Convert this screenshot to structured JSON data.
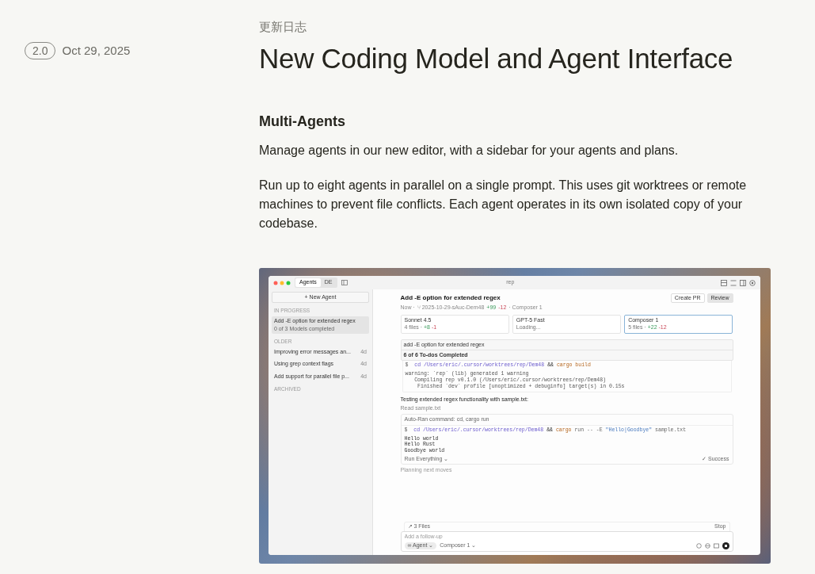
{
  "version": "2.0",
  "date": "Oct 29, 2025",
  "section_label": "更新日志",
  "title": "New Coding Model and Agent Interface",
  "heading": "Multi-Agents",
  "paragraphs": [
    "Manage agents in our new editor, with a sidebar for your agents and plans.",
    "Run up to eight agents in parallel on a single prompt. This uses git worktrees or remote machines to prevent file conflicts. Each agent operates in its own isolated copy of your codebase."
  ],
  "app": {
    "tabs": [
      {
        "label": "Agents",
        "selected": true
      },
      {
        "label": "DE",
        "selected": false
      }
    ],
    "window_title": "rep",
    "new_agent": "+ New Agent",
    "sidebar_sections": [
      {
        "label": "IN PROGRESS",
        "items": [
          {
            "title": "Add -E option for extended regex",
            "status": "0 of 3 Models completed",
            "selected": true
          }
        ]
      },
      {
        "label": "OLDER",
        "items": [
          {
            "title": "Improving error messages an...",
            "time": "4d",
            "selected": false
          },
          {
            "title": "Using grep context flags",
            "time": "4d",
            "selected": false
          },
          {
            "title": "Add support for parallel file p...",
            "time": "4d",
            "selected": false
          }
        ]
      },
      {
        "label": "ARCHIVED"
      }
    ],
    "agent_title": "Add -E option for extended regex",
    "buttons": [
      {
        "label": "Create PR",
        "kind": "outline"
      },
      {
        "label": "Review",
        "kind": "filled"
      }
    ],
    "meta": {
      "time": "Now ·",
      "branch": "⑂ 2025-10-29-sAuc-Dem48",
      "added": "+99",
      "removed": "-12",
      "model": "· Composer 1"
    },
    "models": [
      {
        "name": "Sonnet 4.5",
        "files": "4 files ·",
        "added": "+8",
        "removed": "-1",
        "selected": false
      },
      {
        "name": "GPT-5 Fast",
        "status": "Loading...",
        "selected": false
      },
      {
        "name": "Composer 1",
        "files": "5 files ·",
        "added": "+22",
        "removed": "-12",
        "selected": true
      }
    ],
    "task_card": {
      "title": "add -E option for extended regex",
      "todos": "6 of 6 To-dos Completed"
    },
    "terminal": {
      "prompt": "$",
      "command": [
        {
          "text": "cd /Users/eric/.cursor/worktrees/rep/Dem48",
          "kind": "path"
        },
        {
          "text": "&&",
          "kind": "op"
        },
        {
          "text": "cargo build",
          "kind": "cmd"
        }
      ],
      "output": [
        "warning: `rep` (lib) generated 1 warning",
        "   Compiling rep v0.1.0 (/Users/eric/.cursor/worktrees/rep/Dem48)",
        "    Finished `dev` profile [unoptimized + debuginfo] target(s) in 0.15s"
      ]
    },
    "message": "Testing extended regex functionality with sample.txt:",
    "read": "Read sample.txt",
    "run_card": {
      "header": "Auto-Ran command: cd, cargo run",
      "prompt": "$",
      "command": [
        {
          "text": "cd /Users/eric/.cursor/worktrees/rep/Dem48",
          "kind": "path"
        },
        {
          "text": "&&",
          "kind": "op"
        },
        {
          "text": "cargo",
          "kind": "cmd"
        },
        {
          "text": "run -- -E",
          "kind": "arg"
        },
        {
          "text": "\"Hello|Goodbye\"",
          "kind": "string"
        },
        {
          "text": "sample.txt",
          "kind": "arg"
        }
      ],
      "output": [
        "Hello world",
        "Hello Rust",
        "Goodbye world"
      ],
      "run_mode": "Run Everything ⌄",
      "result": "✓ Success"
    },
    "status": "Planning next moves",
    "files_bar": {
      "label": "↗ 3 Files",
      "stop": "Stop"
    },
    "composer": {
      "placeholder": "Add a follow-up",
      "mode": "∞ Agent ⌄",
      "model": "Composer 1 ⌄"
    }
  }
}
